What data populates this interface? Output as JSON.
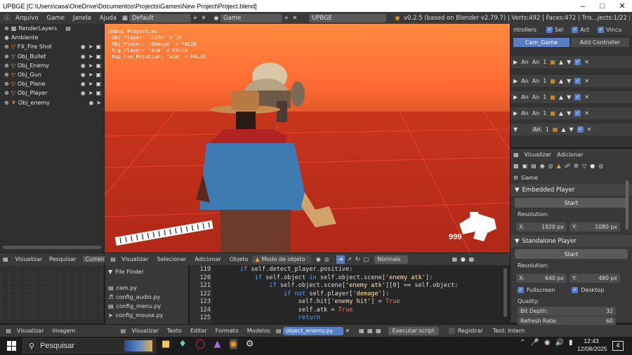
{
  "titlebar": {
    "title": "UPBGE [C:\\Users\\casa\\OneDrive\\Documentos\\Projects\\Games\\New Project\\Project.blend]"
  },
  "header": {
    "menus": [
      "Arquivo",
      "Game",
      "Janela",
      "Ajuda"
    ],
    "layout": "Default",
    "scene": "Game",
    "engine": "UPBGE",
    "version_info": "v0.2.5 (based on Blender v2.79.7) | Verts:492 | Faces:472 | Tris...jects:1/22 | Lamps:0/1"
  },
  "outliner": {
    "items": [
      {
        "label": "RenderLayers",
        "visible_icons": false
      },
      {
        "label": "Ambiente",
        "visible_icons": false
      },
      {
        "label": "FX_Fire Shot",
        "visible_icons": true
      },
      {
        "label": "Obj_Bullet",
        "visible_icons": true
      },
      {
        "label": "Obj_Enemy",
        "visible_icons": true
      },
      {
        "label": "Obj_Gun",
        "visible_icons": true
      },
      {
        "label": "Obj_Plane",
        "visible_icons": true
      },
      {
        "label": "Obj_Player",
        "visible_icons": true
      },
      {
        "label": "Obj_enemy",
        "visible_icons": true
      }
    ]
  },
  "viewport": {
    "debug_title": "Debug Properties",
    "debug_lines": [
      "Obj_Player: 'life' = 20",
      "Obj_Player: 'demage' = FALSE",
      "Rig_Player: 'aim' = FALSE",
      "Esp_Cam_Rotation: 'aim' = FALSE"
    ],
    "hp_counter": "999"
  },
  "logic": {
    "controllers_label": "ntrollers",
    "sel_label": "Sel",
    "act_label": "Act",
    "link_label": "Vincu",
    "cam_game": "Cam_Game",
    "add_controller": "Add Controller",
    "rows": [
      {
        "a": "An",
        "b": "An",
        "c": "1"
      },
      {
        "a": "An",
        "b": "An",
        "c": "1"
      },
      {
        "a": "An",
        "b": "An",
        "c": "1"
      },
      {
        "a": "An",
        "b": "An",
        "c": "1"
      },
      {
        "a": "",
        "b": "An",
        "c": "1"
      }
    ]
  },
  "props": {
    "tabs": [
      "Visualizar",
      "Adicionar"
    ],
    "context": "Game",
    "embedded_header": "Embedded Player",
    "start_label": "Start",
    "resolution_label": "Resolution:",
    "embedded_x": "X:",
    "embedded_x_val": "1920 px",
    "embedded_y": "Y:",
    "embedded_y_val": "1080 px",
    "standalone_header": "Standalone Player",
    "standalone_start": "Start",
    "standalone_resolution": "Resolution:",
    "standalone_x": "X:",
    "standalone_x_val": "640 px",
    "standalone_y": "Y:",
    "standalone_y_val": "480 px",
    "fullscreen": "Fullscreen",
    "desktop": "Desktop",
    "quality": "Quality:",
    "bit_depth": "Bit Depth:",
    "bit_depth_val": "32",
    "refresh_rate": "Refresh Rate:",
    "refresh_rate_val": "60"
  },
  "vp_header": {
    "items": [
      "Visualizar",
      "Selecionar",
      "Adicionar",
      "Objeto"
    ],
    "mode": "Modo de objeto",
    "shading": "Normais"
  },
  "left_bottom": {
    "items": [
      "Visualizar",
      "Pesquisar",
      "Current"
    ]
  },
  "filebrowser": {
    "header": "File Finder",
    "files": [
      "cam.py",
      "config_audio.py",
      "config_menu.py",
      "config_mouse.py"
    ]
  },
  "texteditor": {
    "lines": [
      {
        "num": "119",
        "indent": "",
        "parts": [
          [
            "kw",
            "if "
          ],
          [
            "n",
            "self.detect_player.positive:"
          ]
        ]
      },
      {
        "num": "120",
        "indent": "    ",
        "parts": [
          [
            "kw",
            "if "
          ],
          [
            "n",
            "self.object "
          ],
          [
            "kw",
            "in "
          ],
          [
            "n",
            "self.object.scene["
          ],
          [
            "str",
            "'enemy atk'"
          ],
          [
            "n",
            "]:"
          ]
        ]
      },
      {
        "num": "121",
        "indent": "        ",
        "parts": [
          [
            "kw",
            "if "
          ],
          [
            "n",
            "self.object.scene["
          ],
          [
            "str",
            "'enemy atk'"
          ],
          [
            "n",
            "][0] == self.object:"
          ]
        ]
      },
      {
        "num": "122",
        "indent": "            ",
        "parts": [
          [
            "kw",
            "if not "
          ],
          [
            "n",
            "self.player["
          ],
          [
            "str",
            "'demage'"
          ],
          [
            "n",
            "]:"
          ]
        ]
      },
      {
        "num": "123",
        "indent": "                ",
        "parts": [
          [
            "n",
            "self.hit["
          ],
          [
            "str",
            "'enemy hit'"
          ],
          [
            "n",
            "] = "
          ],
          [
            "bool",
            "True"
          ]
        ]
      },
      {
        "num": "124",
        "indent": "                ",
        "parts": [
          [
            "n",
            "self.atk = "
          ],
          [
            "bool",
            "True"
          ]
        ]
      },
      {
        "num": "125",
        "indent": "                ",
        "parts": [
          [
            "kw",
            "return"
          ]
        ]
      }
    ]
  },
  "bottom_hdr": {
    "left": [
      "Visualizar",
      "Imagem"
    ],
    "right": [
      "Visualizar",
      "Texto",
      "Editar",
      "Formato",
      "Modelos"
    ],
    "text_file": "object_enemy.py",
    "run_script": "Executar script",
    "register": "Registrar",
    "internal": "Text: Intern"
  },
  "taskbar": {
    "search_placeholder": "Pesquisar",
    "time": "12:43",
    "date": "12/08/2025",
    "notifications": "4"
  }
}
